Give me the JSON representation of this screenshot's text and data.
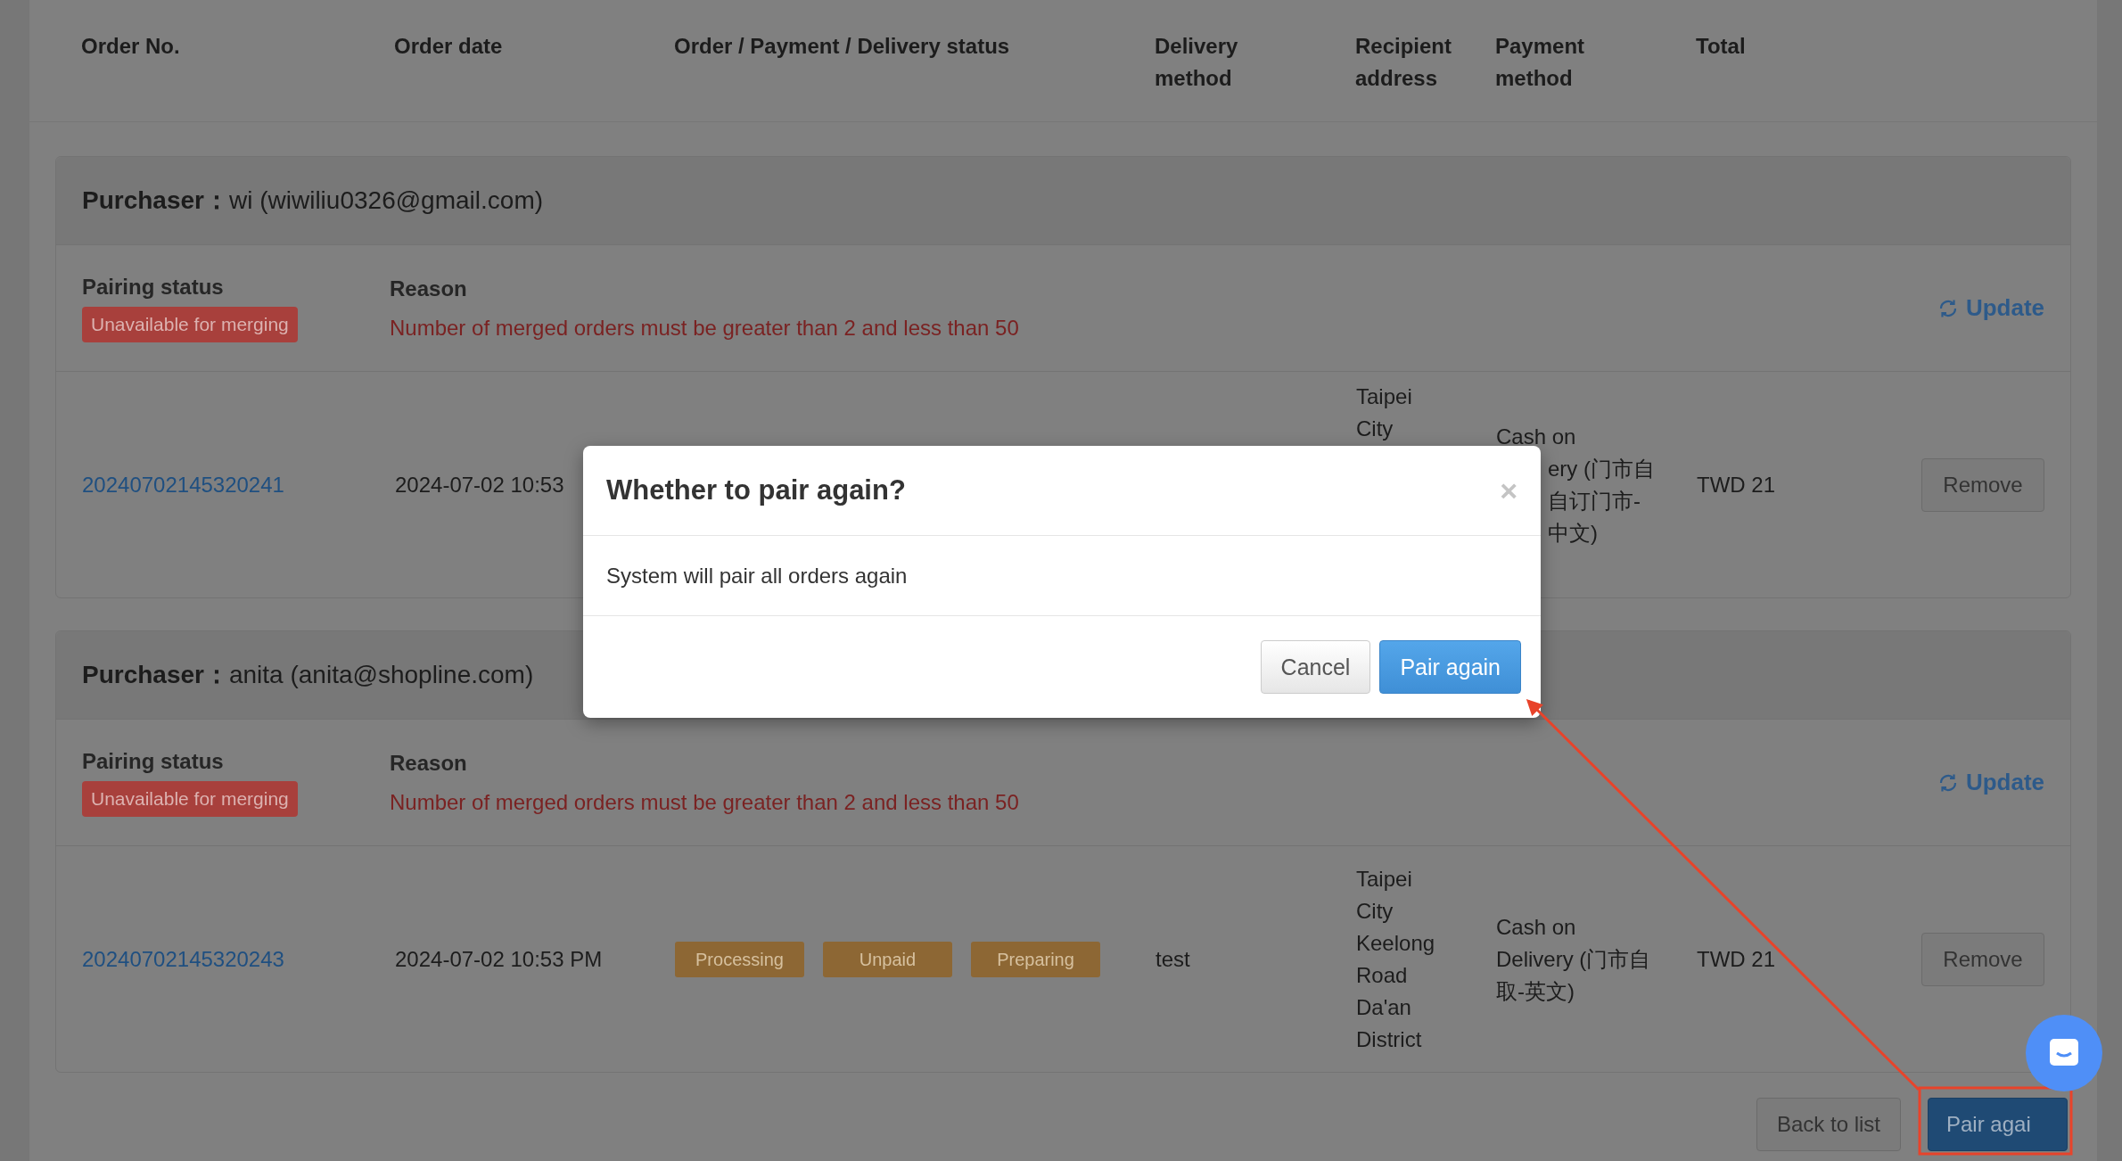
{
  "columns": [
    "Order No.",
    "Order date",
    "Order / Payment / Delivery status",
    "Delivery method",
    "Recipient address",
    "Payment method",
    "Total"
  ],
  "purchasers": [
    {
      "heading": "**Purchaser：**wi (wiwiliu0326@gmail.com)",
      "pairing_label": "Pairing status",
      "pairing_status": "Unavailable for merging",
      "reason_label": "Reason",
      "reason": "Number of merged orders must be greater than 2 and less than 50",
      "update": "Update",
      "order": {
        "number": "20240702145320241",
        "date": "2024-07-02 10:53",
        "address": "Taipei City",
        "payment_lines": [
          {
            "text": "Cash on",
            "kind": "full"
          },
          {
            "text": "ery (门市自",
            "kind": "clipped"
          },
          {
            "text": "自订门市-",
            "kind": "clipped"
          },
          {
            "text": "中文)",
            "kind": "clipped"
          }
        ],
        "total": "TWD 21",
        "remove": "Remove"
      }
    },
    {
      "heading": "**Purchaser：**anita (anita@shopline.com)",
      "pairing_label": "Pairing status",
      "pairing_status": "Unavailable for merging",
      "reason_label": "Reason",
      "reason": "Number of merged orders must be greater than 2 and less than 50",
      "update": "Update",
      "order": {
        "number": "20240702145320243",
        "date": "2024-07-02 10:53 PM",
        "statuses": [
          "Processing",
          "Unpaid",
          "Preparing"
        ],
        "delivery_method": "test",
        "address": "Taipei City Keelong Road Da'an District",
        "payment_lines": [
          {
            "text": "Cash on",
            "kind": "full"
          },
          {
            "text": "Delivery (门市自",
            "kind": "full"
          },
          {
            "text": "取-英文)",
            "kind": "full"
          }
        ],
        "total": "TWD 21",
        "remove": "Remove"
      }
    }
  ],
  "footer_buttons": [
    {
      "label": "Back to list",
      "kind": "default"
    },
    {
      "label": "Pair agai",
      "kind": "primary"
    }
  ],
  "modal": {
    "title": "Whether to pair again?",
    "close": "×",
    "body": "System will pair all orders again",
    "buttons": [
      {
        "label": "Cancel",
        "kind": "default"
      },
      {
        "label": "Pair again",
        "kind": "primary"
      }
    ]
  }
}
